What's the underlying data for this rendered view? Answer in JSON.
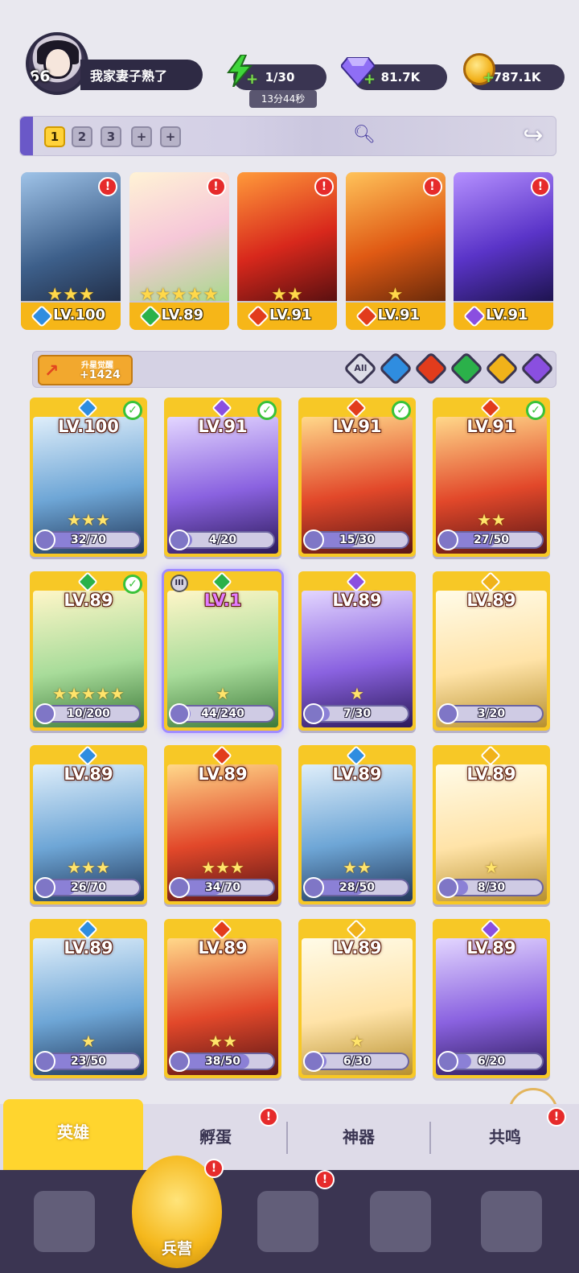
{
  "profile": {
    "level": "66",
    "name": "我家妻子熟了",
    "avatar_icon": "player-avatar"
  },
  "resources": {
    "energy": "1/30",
    "energy_timer": "13分44秒",
    "gems": "81.7K",
    "gold": "787.1K"
  },
  "team_tabs": [
    "1",
    "2",
    "3",
    "+",
    "+"
  ],
  "active_team_tab": "1",
  "team_slots": [
    {
      "level": "LV.100",
      "element": "water",
      "stars": "★★★",
      "alert": "!"
    },
    {
      "level": "LV.89",
      "element": "wind",
      "stars": "★★★★★",
      "alert": "!"
    },
    {
      "level": "LV.91",
      "element": "fire",
      "stars": "★★",
      "alert": "!"
    },
    {
      "level": "LV.91",
      "element": "fire",
      "stars": "★",
      "alert": "!"
    },
    {
      "level": "LV.91",
      "element": "dark",
      "stars": "",
      "alert": "!"
    }
  ],
  "upgrade": {
    "label": "升星觉醒",
    "value": "+1424"
  },
  "filters": {
    "all_label": "All",
    "elements": [
      "water",
      "fire",
      "wind",
      "light",
      "dark"
    ]
  },
  "element_colors": {
    "water": "#2f8de0",
    "fire": "#e23c1c",
    "wind": "#2bb14a",
    "light": "#f0b21a",
    "dark": "#8a4fe0"
  },
  "heroes": [
    {
      "level": "LV.100",
      "element": "water",
      "stars": "★★★",
      "shards": "32/70",
      "progress": 0.46,
      "equipped": true
    },
    {
      "level": "LV.91",
      "element": "dark",
      "stars": "",
      "shards": "4/20",
      "progress": 0.2,
      "equipped": true
    },
    {
      "level": "LV.91",
      "element": "fire",
      "stars": "",
      "shards": "15/30",
      "progress": 0.5,
      "equipped": true
    },
    {
      "level": "LV.91",
      "element": "fire",
      "stars": "★★",
      "shards": "27/50",
      "progress": 0.54,
      "equipped": true
    },
    {
      "level": "LV.89",
      "element": "wind",
      "stars": "★★★★★",
      "shards": "10/200",
      "progress": 0.05,
      "equipped": true
    },
    {
      "level": "LV.1",
      "element": "wind",
      "stars": "★",
      "shards": "44/240",
      "progress": 0.18,
      "equipped": false,
      "rank": "III"
    },
    {
      "level": "LV.89",
      "element": "dark",
      "stars": "★",
      "shards": "7/30",
      "progress": 0.23,
      "equipped": false
    },
    {
      "level": "LV.89",
      "element": "light",
      "stars": "",
      "shards": "3/20",
      "progress": 0.15,
      "equipped": false
    },
    {
      "level": "LV.89",
      "element": "water",
      "stars": "★★★",
      "shards": "26/70",
      "progress": 0.37,
      "equipped": false
    },
    {
      "level": "LV.89",
      "element": "fire",
      "stars": "★★★",
      "shards": "34/70",
      "progress": 0.49,
      "equipped": false
    },
    {
      "level": "LV.89",
      "element": "water",
      "stars": "★★",
      "shards": "28/50",
      "progress": 0.56,
      "equipped": false
    },
    {
      "level": "LV.89",
      "element": "light",
      "stars": "★",
      "shards": "8/30",
      "progress": 0.27,
      "equipped": false
    },
    {
      "level": "LV.89",
      "element": "water",
      "stars": "★",
      "shards": "23/50",
      "progress": 0.46,
      "equipped": false
    },
    {
      "level": "LV.89",
      "element": "fire",
      "stars": "★★",
      "shards": "38/50",
      "progress": 0.76,
      "equipped": false
    },
    {
      "level": "LV.89",
      "element": "light",
      "stars": "★",
      "shards": "6/30",
      "progress": 0.2,
      "equipped": false
    },
    {
      "level": "LV.89",
      "element": "dark",
      "stars": "",
      "shards": "6/20",
      "progress": 0.3,
      "equipped": false
    }
  ],
  "sub_tabs": [
    {
      "label": "英雄",
      "active": true,
      "alert": ""
    },
    {
      "label": "孵蛋",
      "active": false,
      "alert": "!"
    },
    {
      "label": "神器",
      "active": false,
      "alert": ""
    },
    {
      "label": "共鸣",
      "active": false,
      "alert": "!"
    }
  ],
  "nav": {
    "home_label": "兵营",
    "alert": "!"
  }
}
